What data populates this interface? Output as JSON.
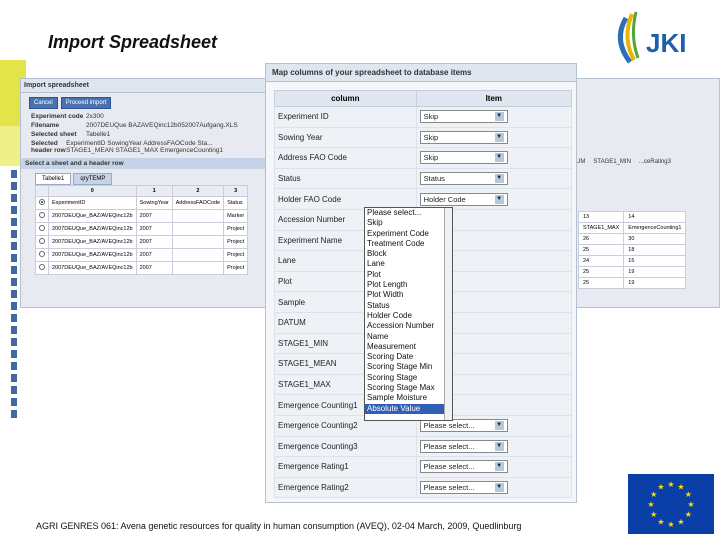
{
  "slide": {
    "title": "Import Spreadsheet",
    "footer": "AGRI GENRES 061: Avena genetic resources for quality in human consumption (AVEQ), 02-04 March, 2009, Quedlinburg",
    "logo_text": "JKI"
  },
  "import_window": {
    "title": "Import spreadsheet",
    "buttons": [
      "Cancel",
      "Proceed import"
    ],
    "info": [
      {
        "key": "Experiment code",
        "value": "2x300"
      },
      {
        "key": "Filename",
        "value": "2007DEUQue BAZAVEQinc12b052007Aufgang.XLS"
      },
      {
        "key": "Selected sheet",
        "value": "Tabelle1"
      },
      {
        "key": "Selected header row",
        "value": "ExperimentID  SowingYear  AddressFAOCode  Sta...  STAGE1_MEAN  STAGE1_MAX  EmergenceCounting1"
      }
    ],
    "section": "Select a sheet and a header row",
    "tabs": [
      "Tabelle1",
      "qryTEMP"
    ],
    "table": {
      "headers": [
        "",
        "0",
        "1",
        "2",
        "3"
      ],
      "rows": [
        [
          "ExperimentID",
          "SowingYear",
          "AddressFAOCode",
          "Status"
        ],
        [
          "2007DEUQue_BAZ/AVEQinc12b",
          "2007",
          "",
          "Marker"
        ],
        [
          "2007DEUQue_BAZ/AVEQinc12b",
          "2007",
          "",
          "Project"
        ],
        [
          "2007DEUQue_BAZ/AVEQinc12b",
          "2007",
          "",
          "Project"
        ],
        [
          "2007DEUQue_BAZ/AVEQinc12b",
          "2007",
          "",
          "Project"
        ],
        [
          "2007DEUQue_BAZ/AVEQinc12b",
          "2007",
          "",
          "Project"
        ]
      ]
    }
  },
  "right_fragment": {
    "header": [
      "UM",
      "STAGE1_MIN",
      "...ceRating3"
    ],
    "col_headers": [
      "13",
      "14"
    ],
    "col_names": [
      "STAGE1_MAX",
      "EmergenceCounting1"
    ],
    "rows": [
      [
        "26",
        "30"
      ],
      [
        "25",
        "18"
      ],
      [
        "24",
        "15"
      ],
      [
        "25",
        "19"
      ],
      [
        "25",
        "19"
      ]
    ]
  },
  "map_dialog": {
    "title": "Map columns of your spreadsheet to database items",
    "col_column": "column",
    "col_item": "Item",
    "rows": [
      {
        "column": "Experiment ID",
        "item": "Skip"
      },
      {
        "column": "Sowing Year",
        "item": "Skip"
      },
      {
        "column": "Address FAO Code",
        "item": "Skip"
      },
      {
        "column": "Status",
        "item": "Status"
      },
      {
        "column": "Holder FAO Code",
        "item": "Holder Code"
      },
      {
        "column": "Accession Number",
        "item": ""
      },
      {
        "column": "Experiment Name",
        "item": ""
      },
      {
        "column": "Lane",
        "item": ""
      },
      {
        "column": "Plot",
        "item": ""
      },
      {
        "column": "Sample",
        "item": ""
      },
      {
        "column": "DATUM",
        "item": ""
      },
      {
        "column": "STAGE1_MIN",
        "item": ""
      },
      {
        "column": "STAGE1_MEAN",
        "item": ""
      },
      {
        "column": "STAGE1_MAX",
        "item": ""
      },
      {
        "column": "Emergence Counting1",
        "item": ""
      },
      {
        "column": "Emergence Counting2",
        "item": "Please select..."
      },
      {
        "column": "Emergence Counting3",
        "item": "Please select..."
      },
      {
        "column": "Emergence Rating1",
        "item": "Please select..."
      },
      {
        "column": "Emergence Rating2",
        "item": "Please select..."
      }
    ],
    "dropdown_options": [
      "Please select...",
      "Skip",
      "Experiment Code",
      "Treatment Code",
      "Block",
      "Lane",
      "Plot",
      "Plot Length",
      "Plot Width",
      "Status",
      "Holder Code",
      "Accession Number",
      "Name",
      "Measurement",
      "Scoring Date",
      "Scoring Stage Min",
      "Scoring Stage",
      "Scoring Stage Max",
      "Sample Moisture",
      "Absolute Value"
    ],
    "dropdown_highlighted": "Absolute Value"
  }
}
